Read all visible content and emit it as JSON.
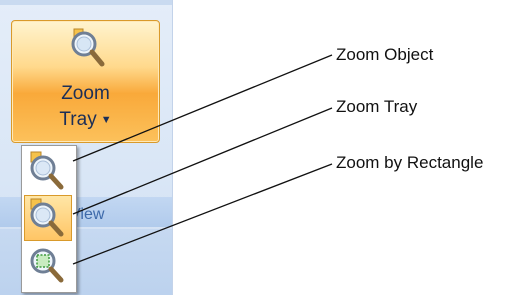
{
  "ribbon": {
    "zoom_button": {
      "line1": "Zoom",
      "line2": "Tray"
    },
    "group_label": "View"
  },
  "dropdown": {
    "items": [
      {
        "icon": "zoom-object-icon"
      },
      {
        "icon": "zoom-tray-icon",
        "highlighted": true
      },
      {
        "icon": "zoom-by-rectangle-icon"
      }
    ]
  },
  "callouts": [
    {
      "label": "Zoom Object"
    },
    {
      "label": "Zoom Tray"
    },
    {
      "label": "Zoom by Rectangle"
    }
  ],
  "colors": {
    "button_gradient_top": "#fff4cf",
    "button_gradient_mid": "#f9a93a",
    "ribbon_bg": "#dbe7f7",
    "group_label_text": "#3e6aaa"
  }
}
